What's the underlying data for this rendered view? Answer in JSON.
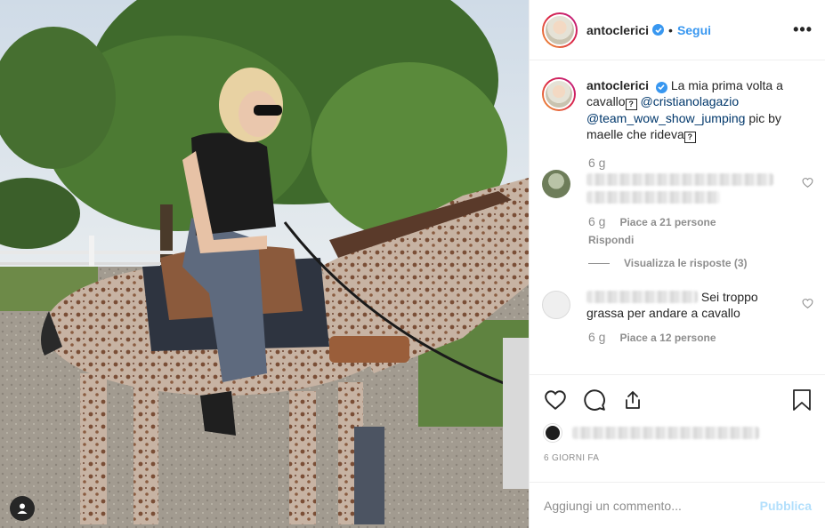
{
  "post": {
    "photo_icon": "horse-rider-photo",
    "user_tag_icon": "user-tag-icon"
  },
  "header": {
    "username": "antoclerici",
    "separator": "•",
    "follow_label": "Segui",
    "more_icon": "more-options-icon",
    "more_label": "•••"
  },
  "caption": {
    "username": "antoclerici",
    "text_1": "La mia prima volta a cavallo",
    "unknown_glyph": "?",
    "mention_1": "@cristianolagazio",
    "mention_2": "@team_wow_show_jumping",
    "text_2": "pic by maelle che rideva",
    "age": "6 g"
  },
  "comments": [
    {
      "text": "",
      "age": "6 g",
      "likes": "Piace a 21 persone",
      "reply_label": "Rispondi",
      "view_replies": "Visualizza le risposte (3)"
    },
    {
      "text": "Sei troppo grassa per andare a cavallo",
      "age": "6 g",
      "likes": "Piace a 12 persone"
    }
  ],
  "actions": {
    "like_icon": "heart-icon",
    "comment_icon": "comment-bubble-icon",
    "share_icon": "share-icon",
    "save_icon": "bookmark-icon"
  },
  "timestamp": "6 GIORNI FA",
  "add_comment": {
    "placeholder": "Aggiungi un commento...",
    "publish_label": "Pubblica"
  },
  "colors": {
    "accent": "#3897f0",
    "publish_disabled": "#b2dffc",
    "muted": "#8e8e8e"
  }
}
